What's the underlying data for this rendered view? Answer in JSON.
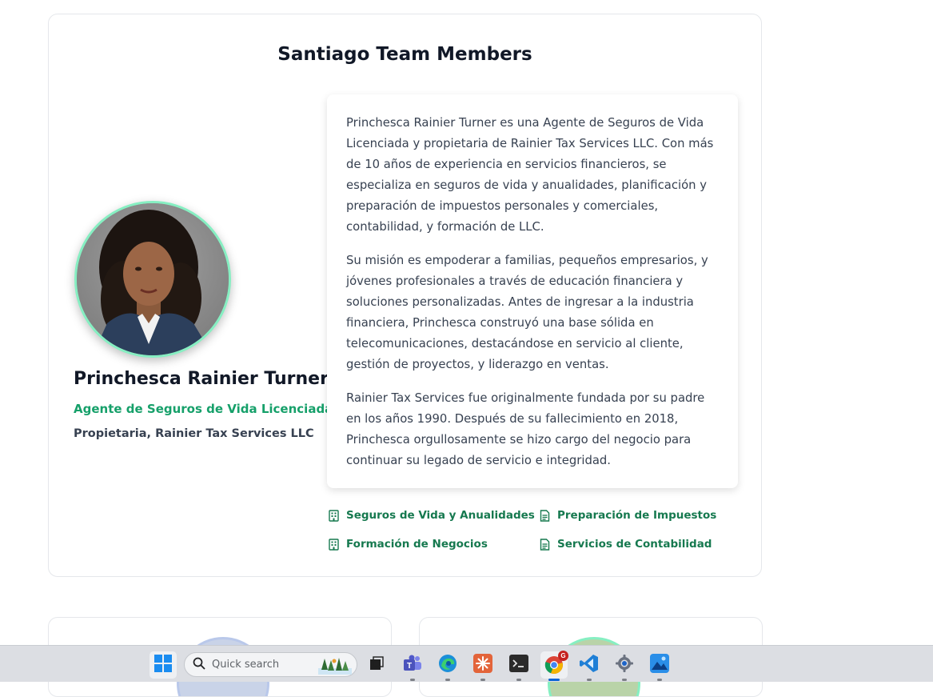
{
  "section": {
    "title": "Santiago Team Members"
  },
  "member": {
    "name": "Princhesca Rainier Turner",
    "title": "Agente de Seguros de Vida Licenciada",
    "company": "Propietaria, Rainier Tax Services LLC",
    "bio": [
      "Princhesca Rainier Turner es una Agente de Seguros de Vida Licenciada y propietaria de Rainier Tax Services LLC. Con más de 10 años de experiencia en servicios financieros, se especializa en seguros de vida y anualidades, planificación y preparación de impuestos personales y comerciales, contabilidad, y formación de LLC.",
      "Su misión es empoderar a familias, pequeños empresarios, y jóvenes profesionales a través de educación financiera y soluciones personalizadas. Antes de ingresar a la industria financiera, Princhesca construyó una base sólida en telecomunicaciones, destacándose en servicio al cliente, gestión de proyectos, y liderazgo en ventas.",
      "Rainier Tax Services fue originalmente fundada por su padre en los años 1990. Después de su fallecimiento en 2018, Princhesca orgullosamente se hizo cargo del negocio para continuar su legado de servicio e integridad."
    ],
    "services": [
      {
        "label": "Seguros de Vida y Anualidades",
        "icon": "building-icon"
      },
      {
        "label": "Preparación de Impuestos",
        "icon": "document-icon"
      },
      {
        "label": "Formación de Negocios",
        "icon": "building-icon"
      },
      {
        "label": "Servicios de Contabilidad",
        "icon": "document-icon"
      }
    ]
  },
  "taskbar": {
    "search_placeholder": "Quick search",
    "chrome_badge": "G",
    "apps": [
      "start-icon",
      "task-view-icon",
      "teams-icon",
      "edge-icon",
      "claude-icon",
      "terminal-icon",
      "chrome-icon",
      "vscode-icon",
      "settings-icon",
      "photos-icon"
    ]
  },
  "colors": {
    "accent_green": "#16a06a",
    "avatar_ring": "#86efc2",
    "service_text": "#16794f"
  }
}
